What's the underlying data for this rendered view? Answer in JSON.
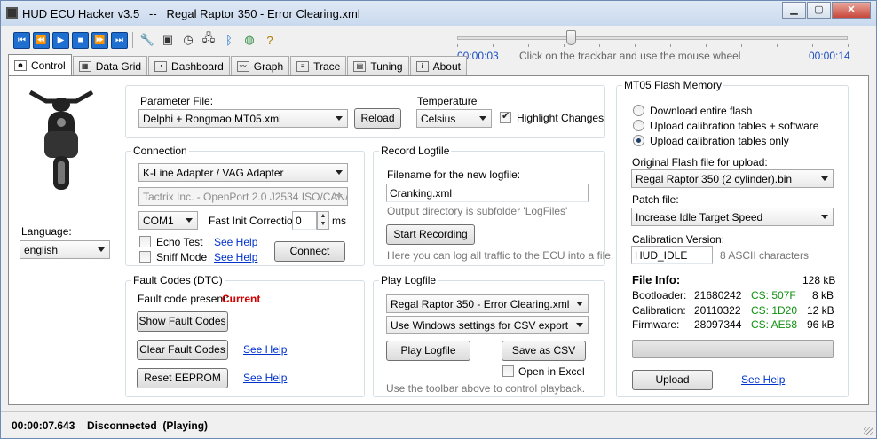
{
  "window": {
    "title": "HUD ECU Hacker v3.5   --   Regal Raptor 350 - Error Clearing.xml"
  },
  "playback": {
    "start_time": "00:00:03",
    "end_time": "00:00:14",
    "hint": "Click on the trackbar and use the mouse wheel",
    "position": 0.29
  },
  "tabs": [
    {
      "label": "Control"
    },
    {
      "label": "Data Grid"
    },
    {
      "label": "Dashboard"
    },
    {
      "label": "Graph"
    },
    {
      "label": "Trace"
    },
    {
      "label": "Tuning"
    },
    {
      "label": "About"
    }
  ],
  "language": {
    "label": "Language:",
    "value": "english"
  },
  "parameter": {
    "label": "Parameter File:",
    "value": "Delphi + Rongmao MT05.xml",
    "reload": "Reload",
    "temp_label": "Temperature",
    "temp_value": "Celsius",
    "highlight": "Highlight Changes"
  },
  "connection": {
    "title": "Connection",
    "adapter": "K-Line Adapter / VAG Adapter",
    "device": "Tactrix Inc. - OpenPort 2.0 J2534 ISO/CAN/",
    "port": "COM1",
    "fast_init_label": "Fast Init Correction",
    "fast_init_value": "0",
    "unit": "ms",
    "echo": "Echo Test",
    "sniff": "Sniff Mode",
    "help1": "See Help",
    "help2": "See Help",
    "connect": "Connect"
  },
  "record": {
    "title": "Record Logfile",
    "filename_label": "Filename for the new logfile:",
    "filename": "Cranking.xml",
    "outdir": "Output directory is subfolder 'LogFiles'",
    "start": "Start Recording",
    "hint": "Here you can log all traffic to the ECU into a file."
  },
  "fault": {
    "title": "Fault Codes (DTC)",
    "present_label": "Fault code present:",
    "present_value": "Current",
    "show": "Show Fault Codes",
    "clear": "Clear Fault Codes",
    "reset": "Reset EEPROM",
    "help1": "See Help",
    "help2": "See Help"
  },
  "play": {
    "title": "Play Logfile",
    "file": "Regal Raptor 350 - Error Clearing.xml",
    "csv_mode": "Use Windows settings for CSV export",
    "play": "Play Logfile",
    "save": "Save as CSV",
    "excel": "Open in Excel",
    "hint": "Use the toolbar above to control playback."
  },
  "flash": {
    "title": "MT05 Flash Memory",
    "options": [
      "Download entire flash",
      "Upload calibration tables + software",
      "Upload calibration tables only"
    ],
    "orig_label": "Original Flash file for upload:",
    "orig_value": "Regal Raptor 350 (2 cylinder).bin",
    "patch_label": "Patch file:",
    "patch_value": "Increase Idle Target Speed",
    "calver_label": "Calibration Version:",
    "calver_value": "HUD_IDLE",
    "calver_hint": "8 ASCII characters",
    "info_label": "File Info:",
    "info_size": "128 kB",
    "rows": [
      {
        "name": "Bootloader:",
        "value": "21680242",
        "cs": "CS: 507F",
        "size": "8 kB"
      },
      {
        "name": "Calibration:",
        "value": "20110322",
        "cs": "CS: 1D20",
        "size": "12 kB"
      },
      {
        "name": "Firmware:",
        "value": "28097344",
        "cs": "CS: AE58",
        "size": "96 kB"
      }
    ],
    "upload": "Upload",
    "help": "See Help"
  },
  "status": {
    "time": "00:00:07.643",
    "state": "Disconnected  (Playing)"
  }
}
